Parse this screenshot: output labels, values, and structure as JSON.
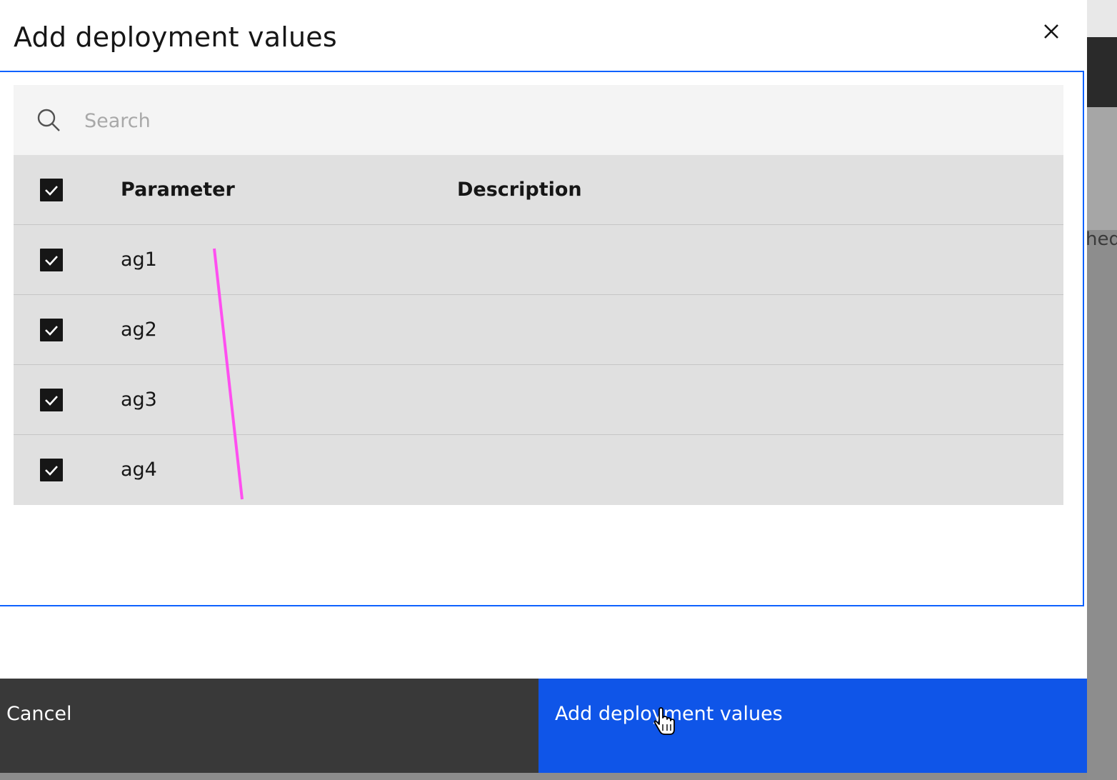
{
  "modal": {
    "title": "Add deployment values"
  },
  "search": {
    "placeholder": "Search",
    "value": ""
  },
  "table": {
    "headers": {
      "parameter": "Parameter",
      "description": "Description"
    },
    "select_all_checked": true,
    "rows": [
      {
        "parameter": "ag1",
        "description": "",
        "checked": true
      },
      {
        "parameter": "ag2",
        "description": "",
        "checked": true
      },
      {
        "parameter": "ag3",
        "description": "",
        "checked": true
      },
      {
        "parameter": "ag4",
        "description": "",
        "checked": true
      }
    ]
  },
  "footer": {
    "cancel_label": "Cancel",
    "primary_label": "Add deployment values"
  },
  "background": {
    "partial_text": "hed"
  },
  "colors": {
    "primary": "#0f55e8",
    "secondary": "#393939",
    "focus": "#0f62fe",
    "annotation": "#ff4ff0"
  },
  "icons": {
    "close": "close-icon",
    "search": "search-icon",
    "checkmark": "checkmark-icon",
    "cursor": "hand-pointer-icon"
  }
}
